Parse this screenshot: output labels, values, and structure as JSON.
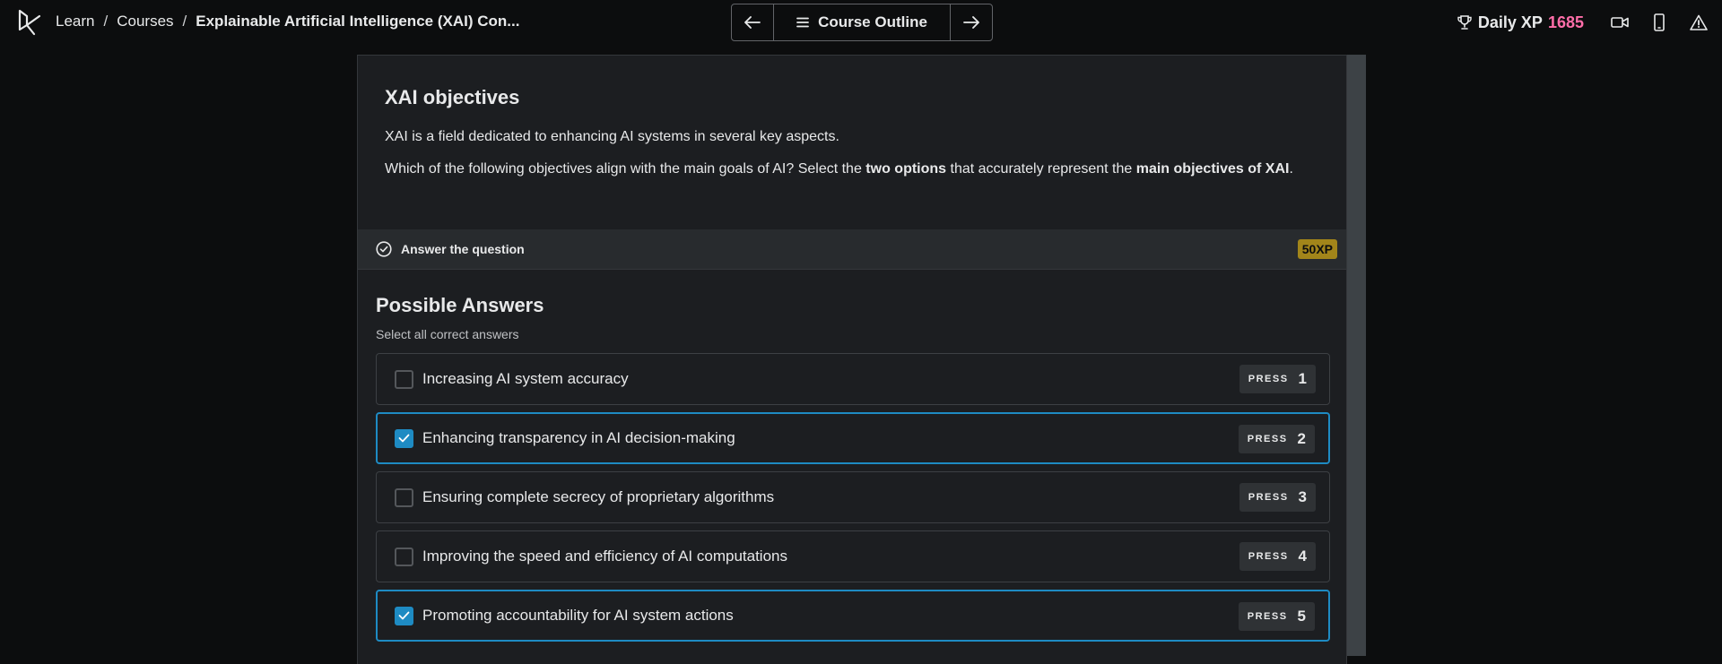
{
  "breadcrumb": {
    "learn": "Learn",
    "courses": "Courses",
    "sep": "/",
    "current": "Explainable Artificial Intelligence (XAI) Con..."
  },
  "course_nav": {
    "outline_label": "Course Outline"
  },
  "xp": {
    "label": "Daily XP",
    "value": "1685",
    "value_color": "#ff6ea9"
  },
  "exercise": {
    "title": "XAI objectives",
    "intro": "XAI is a field dedicated to enhancing AI systems in several key aspects.",
    "question_pre": "Which of the following objectives align with the main goals of AI? Select the ",
    "question_bold1": "two options",
    "question_mid": " that accurately represent the ",
    "question_bold2": "main objectives of XAI",
    "question_post": "."
  },
  "answer_bar": {
    "label": "Answer the question",
    "xp_badge": "50XP"
  },
  "answers": {
    "heading": "Possible Answers",
    "hint": "Select all correct answers",
    "press_label": "PRESS",
    "options": [
      {
        "text": "Increasing AI system accuracy",
        "key": "1",
        "checked": false
      },
      {
        "text": "Enhancing transparency in AI decision-making",
        "key": "2",
        "checked": true
      },
      {
        "text": "Ensuring complete secrecy of proprietary algorithms",
        "key": "3",
        "checked": false
      },
      {
        "text": "Improving the speed and efficiency of AI computations",
        "key": "4",
        "checked": false
      },
      {
        "text": "Promoting accountability for AI system actions",
        "key": "5",
        "checked": true
      }
    ]
  },
  "colors": {
    "accent": "#1e8bc3",
    "xp_badge": "#a2851a",
    "background": "#0c0d0e",
    "panel": "#1c1e21"
  },
  "icons": {
    "logo": "datacamp-logo-icon",
    "prev": "arrow-left-icon",
    "next": "arrow-right-icon",
    "outline": "menu-icon",
    "trophy": "trophy-icon",
    "video": "video-icon",
    "mobile": "mobile-icon",
    "report": "warning-icon",
    "answer": "check-circle-icon",
    "checkbox": "checkmark-icon"
  }
}
